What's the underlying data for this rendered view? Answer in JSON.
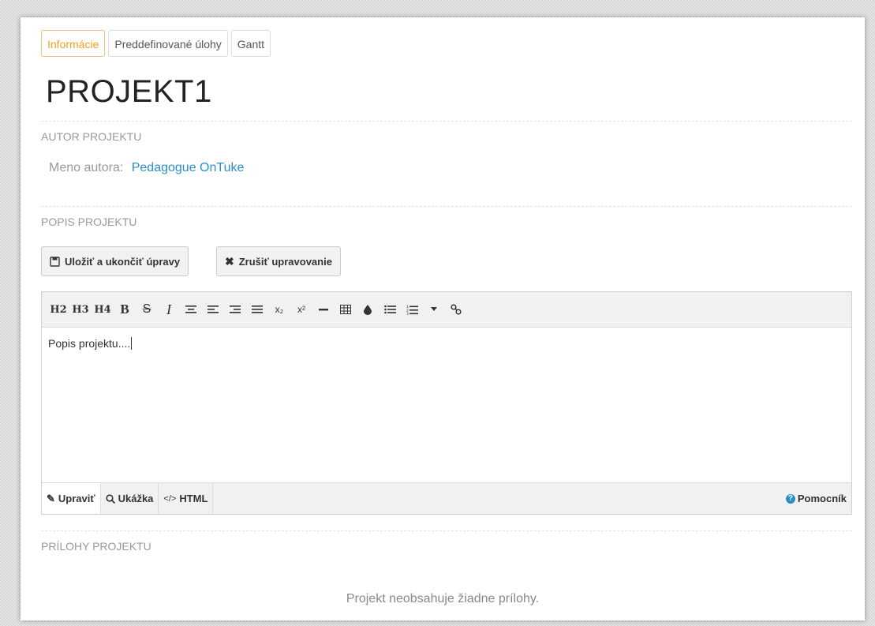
{
  "tabs": [
    "Informácie",
    "Preddefinované úlohy",
    "Gantt"
  ],
  "project": {
    "title": "PROJEKT1"
  },
  "author": {
    "section_label": "AUTOR PROJEKTU",
    "name_label": "Meno autora:",
    "name": "Pedagogue OnTuke"
  },
  "description": {
    "section_label": "POPIS PROJEKTU",
    "save_label": "Uložiť a ukončiť úpravy",
    "cancel_label": "Zrušiť upravovanie",
    "content": "Popis projektu...."
  },
  "editor": {
    "toolbar": {
      "h2": "H2",
      "h3": "H3",
      "h4": "H4",
      "bold": "B",
      "strike": "S",
      "italic": "I",
      "subscript": "x₂",
      "superscript": "x²"
    },
    "footer": {
      "edit": "Upraviť",
      "preview": "Ukážka",
      "html": "HTML",
      "help": "Pomocník"
    }
  },
  "attachments": {
    "section_label": "PRÍLOHY PROJEKTU",
    "empty_text": "Projekt neobsahuje žiadne prílohy."
  },
  "colors": {
    "accent": "#f0a020",
    "link": "#2a8fc4"
  }
}
